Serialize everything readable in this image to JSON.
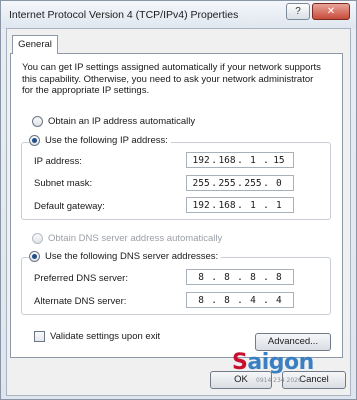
{
  "window": {
    "title": "Internet Protocol Version 4 (TCP/IPv4) Properties",
    "help_label": "?",
    "close_label": "✕"
  },
  "tab": {
    "label": "General"
  },
  "description": "You can get IP settings assigned automatically if your network supports this capability. Otherwise, you need to ask your network administrator for the appropriate IP settings.",
  "ip_section": {
    "auto_label": "Obtain an IP address automatically",
    "manual_label": "Use the following IP address:",
    "selected": "manual",
    "fields": [
      {
        "label": "IP address:",
        "octets": [
          "192",
          "168",
          "1",
          "15"
        ]
      },
      {
        "label": "Subnet mask:",
        "octets": [
          "255",
          "255",
          "255",
          "0"
        ]
      },
      {
        "label": "Default gateway:",
        "octets": [
          "192",
          "168",
          "1",
          "1"
        ]
      }
    ]
  },
  "dns_section": {
    "auto_label": "Obtain DNS server address automatically",
    "manual_label": "Use the following DNS server addresses:",
    "selected": "manual",
    "fields": [
      {
        "label": "Preferred DNS server:",
        "octets": [
          "8",
          "8",
          "8",
          "8"
        ]
      },
      {
        "label": "Alternate DNS server:",
        "octets": [
          "8",
          "8",
          "4",
          "4"
        ]
      }
    ]
  },
  "validate_label": "Validate settings upon exit",
  "advanced_label": "Advanced...",
  "ok_label": "OK",
  "cancel_label": "Cancel",
  "watermark": {
    "brand": "Saigon",
    "sub": "0914 234 2026"
  }
}
